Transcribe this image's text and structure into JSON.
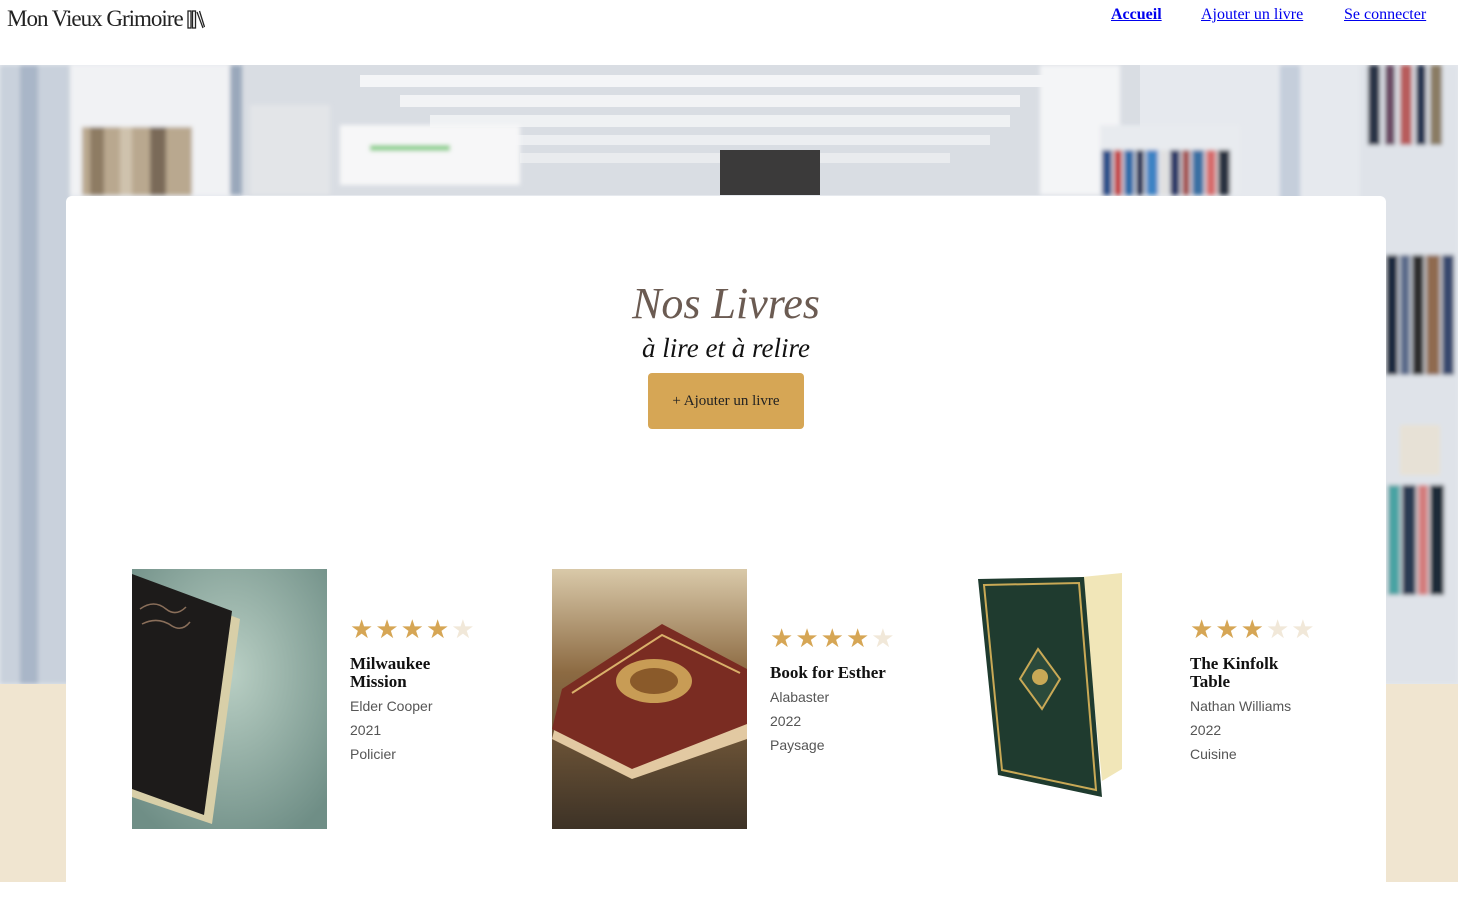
{
  "header": {
    "logo": "Mon Vieux Grimoire",
    "nav": {
      "home": "Accueil",
      "add_book": "Ajouter un livre",
      "login": "Se connecter"
    }
  },
  "main": {
    "title": "Nos Livres",
    "subtitle": "à lire et à relire",
    "add_button": "+ Ajouter un livre"
  },
  "books": [
    {
      "title": "Milwaukee Mission",
      "author": "Elder Cooper",
      "year": "2021",
      "genre": "Policier",
      "rating": 4
    },
    {
      "title": "Book for Esther",
      "author": "Alabaster",
      "year": "2022",
      "genre": "Paysage",
      "rating": 4
    },
    {
      "title": "The Kinfolk Table",
      "author": "Nathan Williams",
      "year": "2022",
      "genre": "Cuisine",
      "rating": 3
    }
  ],
  "colors": {
    "accent": "#d6a655",
    "star_empty": "#f1e8d9",
    "title": "#6b5b52",
    "footer_band": "#f0e5d0"
  }
}
